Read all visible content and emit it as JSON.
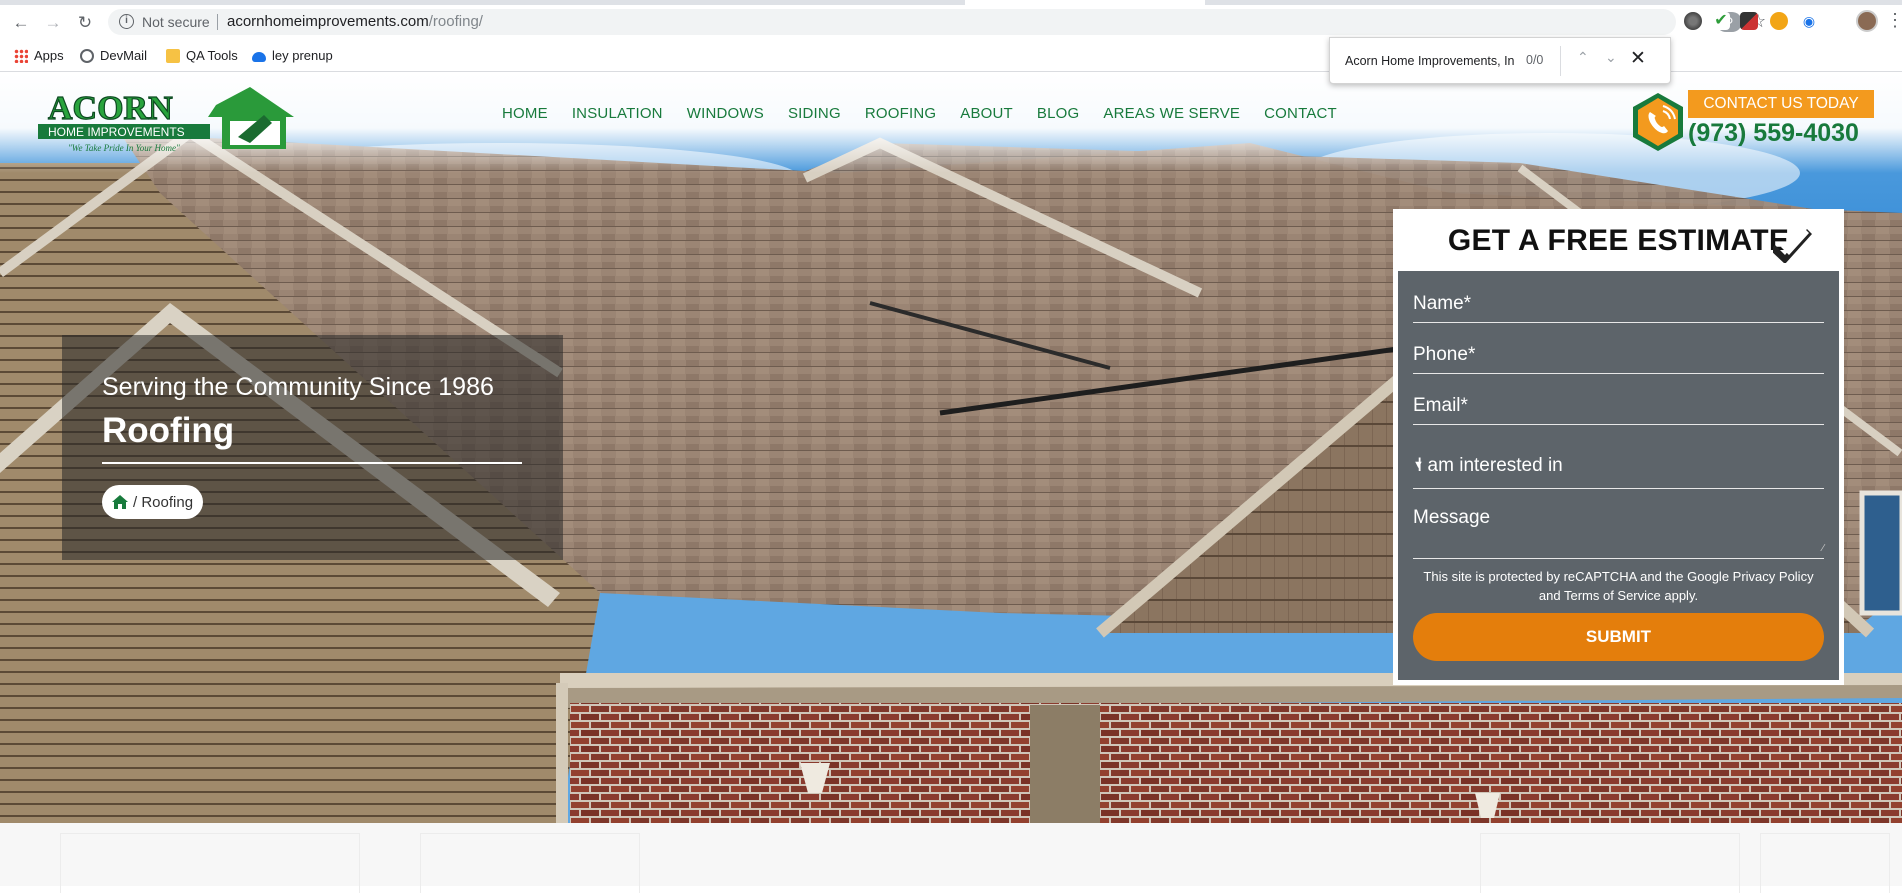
{
  "browser": {
    "security_label": "Not secure",
    "url_domain": "acornhomeimprovements.com",
    "url_path": "/roofing/",
    "bookmarks": [
      {
        "label": "Apps"
      },
      {
        "label": "DevMail"
      },
      {
        "label": "QA Tools"
      },
      {
        "label": "ley prenup"
      }
    ],
    "find": {
      "query": "Acorn Home Improvements, In",
      "count": "0/0"
    }
  },
  "header": {
    "logo": {
      "brand": "ACORN",
      "subtitle": "HOME IMPROVEMENTS",
      "tagline": "\"We Take Pride In Your Home\""
    },
    "nav": [
      {
        "label": "HOME"
      },
      {
        "label": "INSULATION"
      },
      {
        "label": "WINDOWS"
      },
      {
        "label": "SIDING"
      },
      {
        "label": "ROOFING"
      },
      {
        "label": "ABOUT"
      },
      {
        "label": "BLOG"
      },
      {
        "label": "AREAS WE SERVE"
      },
      {
        "label": "CONTACT"
      }
    ],
    "cta_label": "CONTACT US TODAY",
    "phone": "(973) 559-4030"
  },
  "hero": {
    "since": "Serving the Community Since 1986",
    "title": "Roofing",
    "breadcrumb_current": "/ Roofing"
  },
  "estimate_form": {
    "heading": "GET A FREE ESTIMATE",
    "name_placeholder": "Name*",
    "phone_placeholder": "Phone*",
    "email_placeholder": "Email*",
    "interest_placeholder": "I am interested in",
    "message_placeholder": "Message",
    "notice": "This site is protected by reCAPTCHA and the Google Privacy Policy and Terms of Service apply.",
    "submit_label": "SUBMIT"
  },
  "colors": {
    "brand_green": "#187a3c",
    "accent_orange": "#f39a1e",
    "submit_orange": "#e47e0c"
  }
}
